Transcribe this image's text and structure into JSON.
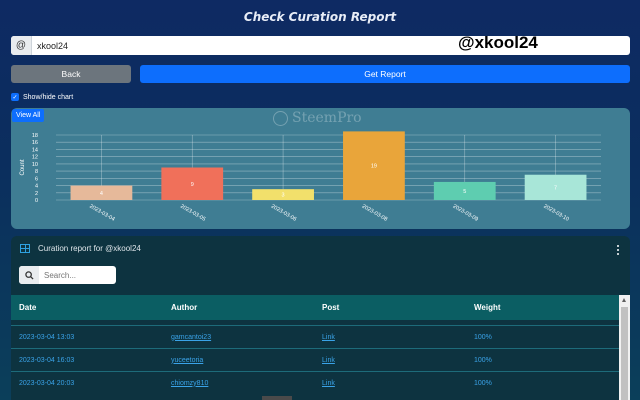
{
  "header": {
    "title": "Check Curation Report"
  },
  "user_input": {
    "prefix": "@",
    "value": "xkool24"
  },
  "overlay_username": "@xkool24",
  "buttons": {
    "back": "Back",
    "get_report": "Get Report"
  },
  "chart_toggle": {
    "label": "Show/hide chart",
    "checked": true
  },
  "chart_panel": {
    "view_all": "View All",
    "watermark": "SteemPro"
  },
  "chart_data": {
    "type": "bar",
    "categories": [
      "2023-03-04",
      "2023-03-05",
      "2023-03-06",
      "2023-03-08",
      "2023-03-09",
      "2023-03-10"
    ],
    "values": [
      4,
      9,
      3,
      19,
      5,
      7
    ],
    "colors": [
      "#e6b99a",
      "#f0705a",
      "#f2e06b",
      "#e9a53a",
      "#5ecdb0",
      "#a8e6d8"
    ],
    "ylabel": "Count",
    "yticks": [
      0,
      2,
      4,
      6,
      8,
      10,
      12,
      14,
      16,
      18
    ],
    "ylim": [
      0,
      18
    ],
    "grid": true
  },
  "report": {
    "title": "Curation report for @xkool24",
    "search_placeholder": "Search...",
    "columns": [
      "Date",
      "Author",
      "Post",
      "Weight"
    ],
    "rows": [
      {
        "date": "2023-03-04 13:03",
        "author": "gamcantoi23",
        "post": "Link",
        "weight": "100%"
      },
      {
        "date": "2023-03-04 16:03",
        "author": "yuceetoria",
        "post": "Link",
        "weight": "100%"
      },
      {
        "date": "2023-03-04 20:03",
        "author": "chiomzy810",
        "post": "Link",
        "weight": "100%"
      }
    ]
  }
}
